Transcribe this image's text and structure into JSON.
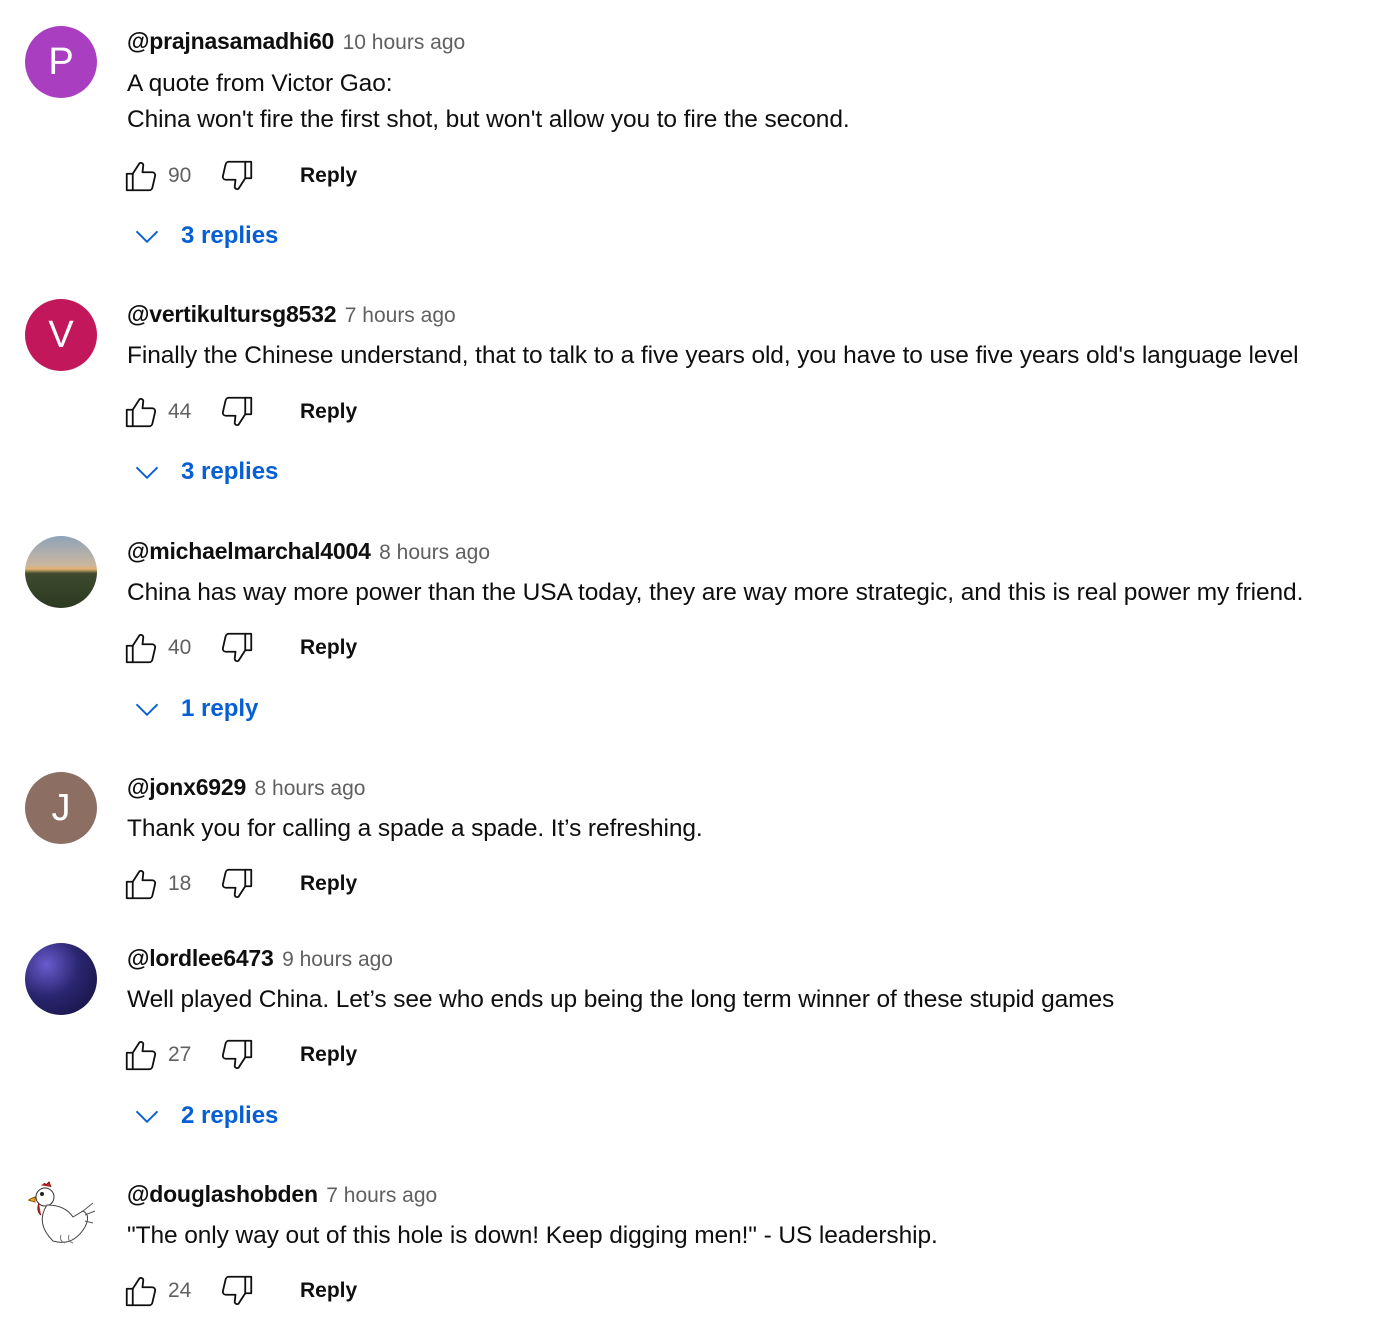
{
  "comments": [
    {
      "author": "@prajnasamadhi60",
      "time": "10 hours ago",
      "lines": [
        "A quote from Victor Gao:",
        "China won't fire the first shot, but won't allow you to fire the second."
      ],
      "likes": "90",
      "reply_label": "Reply",
      "replies_label": "3 replies",
      "avatar_letter": "P",
      "avatar_color": "#a93fc0"
    },
    {
      "author": "@vertikultursg8532",
      "time": "7 hours ago",
      "lines": [
        "Finally the Chinese understand, that to talk to a five years old, you have to use five years old's language level"
      ],
      "likes": "44",
      "reply_label": "Reply",
      "replies_label": "3 replies",
      "avatar_letter": "V",
      "avatar_color": "#c2185b"
    },
    {
      "author": "@michaelmarchal4004",
      "time": "8 hours ago",
      "lines": [
        "China has way more power than the USA today, they are way more strategic, and this is real power my friend."
      ],
      "likes": "40",
      "reply_label": "Reply",
      "replies_label": "1 reply",
      "avatar_letter": "",
      "avatar_color": "#3b4a30"
    },
    {
      "author": "@jonx6929",
      "time": "8 hours ago",
      "lines": [
        "Thank you for calling a spade a spade. It’s refreshing."
      ],
      "likes": "18",
      "reply_label": "Reply",
      "replies_label": "",
      "avatar_letter": "J",
      "avatar_color": "#8d6e63"
    },
    {
      "author": "@lordlee6473",
      "time": "9 hours ago",
      "lines": [
        "Well played China. Let’s see who ends up being the long term winner of these stupid games"
      ],
      "likes": "27",
      "reply_label": "Reply",
      "replies_label": "2 replies",
      "avatar_letter": "",
      "avatar_color": "#2a2670"
    },
    {
      "author": "@douglashobden",
      "time": "7 hours ago",
      "lines": [
        "\"The only way out of this hole is down! Keep digging men!\" - US leadership."
      ],
      "likes": "24",
      "reply_label": "Reply",
      "replies_label": "",
      "avatar_letter": "",
      "avatar_color": "#ffffff"
    }
  ]
}
